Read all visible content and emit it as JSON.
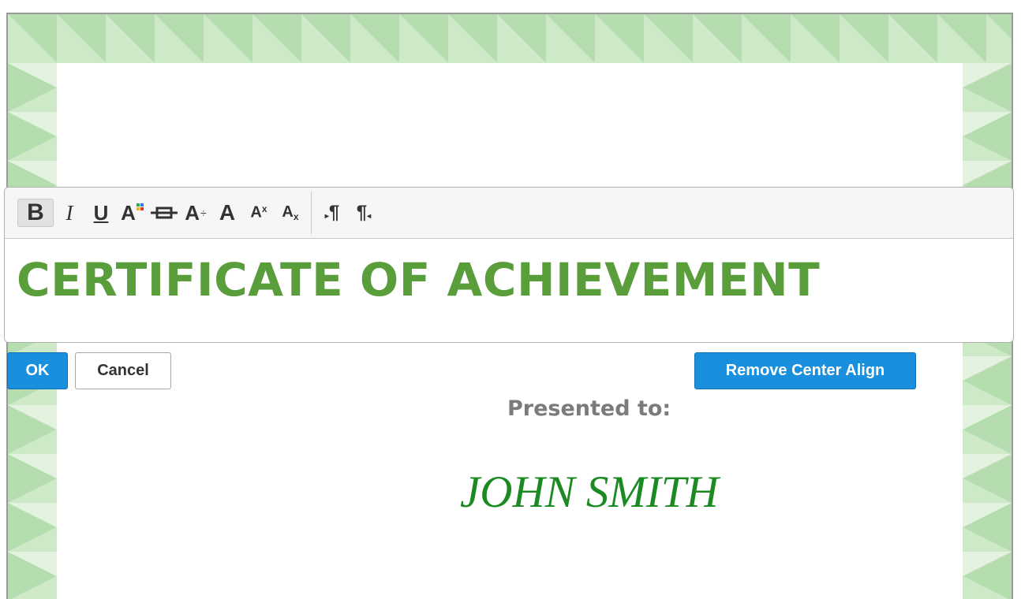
{
  "certificate": {
    "title": "CERTIFICATE OF ACHIEVEMENT",
    "presented_label": "Presented to:",
    "recipient_name": "JOHN SMITH",
    "title_color": "#5a9e3c",
    "name_color": "#1c8a22",
    "border_colors": [
      "#cde9c8",
      "#b6ddb0",
      "#e3f3e0"
    ]
  },
  "toolbar": {
    "bold_label": "B",
    "italic_label": "I",
    "underline_label": "U",
    "font_color_label": "A",
    "font_size_label": "A",
    "font_family_label": "A",
    "superscript_base": "A",
    "superscript_mark": "x",
    "subscript_base": "A",
    "subscript_mark": "x",
    "ltr_label": "¶",
    "rtl_label": "¶",
    "icons": [
      "bold-icon",
      "italic-icon",
      "underline-icon",
      "font-color-icon",
      "strikethrough-icon",
      "font-size-icon",
      "font-family-icon",
      "superscript-icon",
      "subscript-icon",
      "ltr-paragraph-icon",
      "rtl-paragraph-icon"
    ]
  },
  "actions": {
    "ok_label": "OK",
    "cancel_label": "Cancel",
    "remove_center_align_label": "Remove Center Align",
    "primary_color": "#1a8fdd"
  }
}
